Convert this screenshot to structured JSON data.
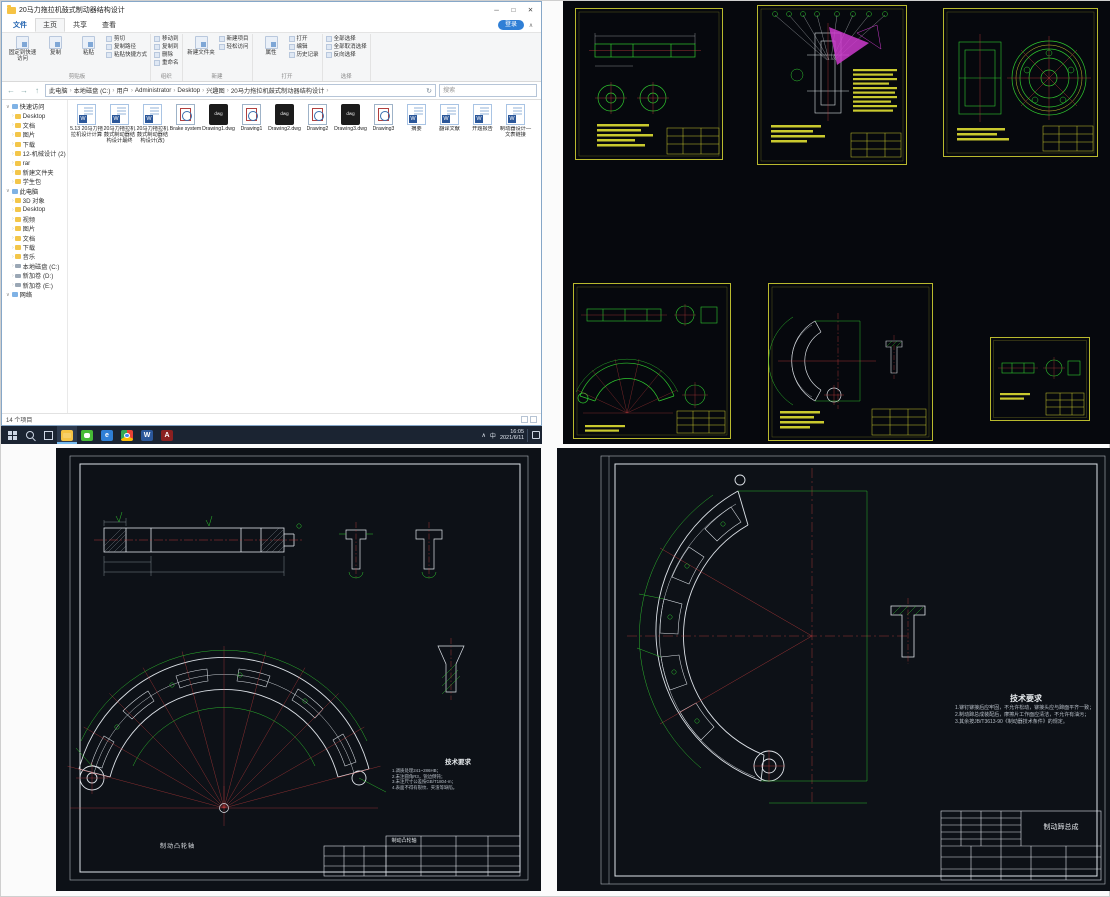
{
  "window": {
    "title": "20马力拖拉机鼓式制动器结构设计",
    "badge": "登录"
  },
  "menu_tabs": [
    "文件",
    "主页",
    "共享",
    "查看"
  ],
  "ribbon": {
    "g1_big": [
      "固定到快速访问",
      "复制",
      "粘贴"
    ],
    "g1_small": [
      "剪切",
      "复制路径",
      "粘贴快捷方式"
    ],
    "g2_small": [
      "移动到",
      "复制到",
      "删除",
      "重命名"
    ],
    "g3_big": [
      "新建文件夹"
    ],
    "g3_small": [
      "新建项目",
      "轻松访问"
    ],
    "g4_big": [
      "属性"
    ],
    "g4_small": [
      "打开",
      "编辑",
      "历史记录"
    ],
    "g5_small": [
      "全部选择",
      "全部取消选择",
      "反向选择"
    ],
    "group_labels": [
      "剪贴板",
      "组织",
      "新建",
      "打开",
      "选择"
    ]
  },
  "address": {
    "breadcrumb": [
      "此电脑",
      "本地磁盘 (C:)",
      "用户",
      "Administrator",
      "Desktop",
      "兴趣图",
      "20马力拖拉机鼓式制动器结构设计"
    ],
    "search_placeholder": "搜索"
  },
  "sidebar": [
    {
      "t": "hdr",
      "label": "快速访问"
    },
    {
      "t": "item",
      "label": "Desktop"
    },
    {
      "t": "item",
      "label": "文档"
    },
    {
      "t": "item",
      "label": "图片"
    },
    {
      "t": "item",
      "label": "下载"
    },
    {
      "t": "item",
      "label": "12-机械设计 (2)"
    },
    {
      "t": "item",
      "label": "rar"
    },
    {
      "t": "item",
      "label": "新建文件夹"
    },
    {
      "t": "item",
      "label": "学生包"
    },
    {
      "t": "hdr",
      "label": "此电脑"
    },
    {
      "t": "item",
      "label": "3D 对象"
    },
    {
      "t": "item",
      "label": "Desktop"
    },
    {
      "t": "item",
      "label": "视频"
    },
    {
      "t": "item",
      "label": "图片"
    },
    {
      "t": "item",
      "label": "文档"
    },
    {
      "t": "item",
      "label": "下载"
    },
    {
      "t": "item",
      "label": "音乐"
    },
    {
      "t": "item",
      "label": "本地磁盘 (C:)",
      "ic": "drive"
    },
    {
      "t": "item",
      "label": "新加卷 (D:)",
      "ic": "drive"
    },
    {
      "t": "item",
      "label": "新加卷 (E:)",
      "ic": "drive"
    },
    {
      "t": "hdr",
      "label": "网络"
    }
  ],
  "files": [
    {
      "name": "5.13 20马力拖拉机设计计算",
      "icon": "doc"
    },
    {
      "name": "20马力拖拉机鼓式制动器结构设计最终",
      "icon": "doc"
    },
    {
      "name": "20马力拖拉机鼓式制动器结构设计(改)",
      "icon": "doc"
    },
    {
      "name": "Brake system",
      "icon": "dwgw"
    },
    {
      "name": "Drawing1.dwg",
      "icon": "dwgb"
    },
    {
      "name": "Drawing1",
      "icon": "dwgw"
    },
    {
      "name": "Drawing2.dwg",
      "icon": "dwgb"
    },
    {
      "name": "Drawing2",
      "icon": "dwgw"
    },
    {
      "name": "Drawing3.dwg",
      "icon": "dwgb"
    },
    {
      "name": "Drawing3",
      "icon": "dwgw"
    },
    {
      "name": "摘要",
      "icon": "doc"
    },
    {
      "name": "翻译文献",
      "icon": "doc"
    },
    {
      "name": "开题报告",
      "icon": "doc"
    },
    {
      "name": "制动器设计—文表链接",
      "icon": "doc"
    }
  ],
  "status": "14 个项目",
  "taskbar": {
    "chevron": "∧",
    "ime": "中",
    "time": "16:05",
    "date": "2021/6/11"
  },
  "drawing_left": {
    "part_label": "制动凸轮轴",
    "tech_title": "技术要求",
    "tech_lines": [
      "1.调质处理241~286HB；",
      "2.未注圆角R3，锐边倒钝；",
      "3.未注尺寸公差按GB/T1804-m；",
      "4.表面不得有裂纹、夹渣等缺陷。"
    ],
    "title_block_name": "制动凸轮轴"
  },
  "drawing_right": {
    "tech_title": "技术要求",
    "tech_lines": [
      "1.铆钉铆接后应牢固，不允许松动，铆接头应与蹄面平齐一致；",
      "2.制动蹄总成装配后，摩擦片工作面应清洁，不允许有油污；",
      "3.其余按JB/T3613-90《制动器技术条件》的规定。"
    ],
    "title_block_name": "制动蹄总成"
  }
}
